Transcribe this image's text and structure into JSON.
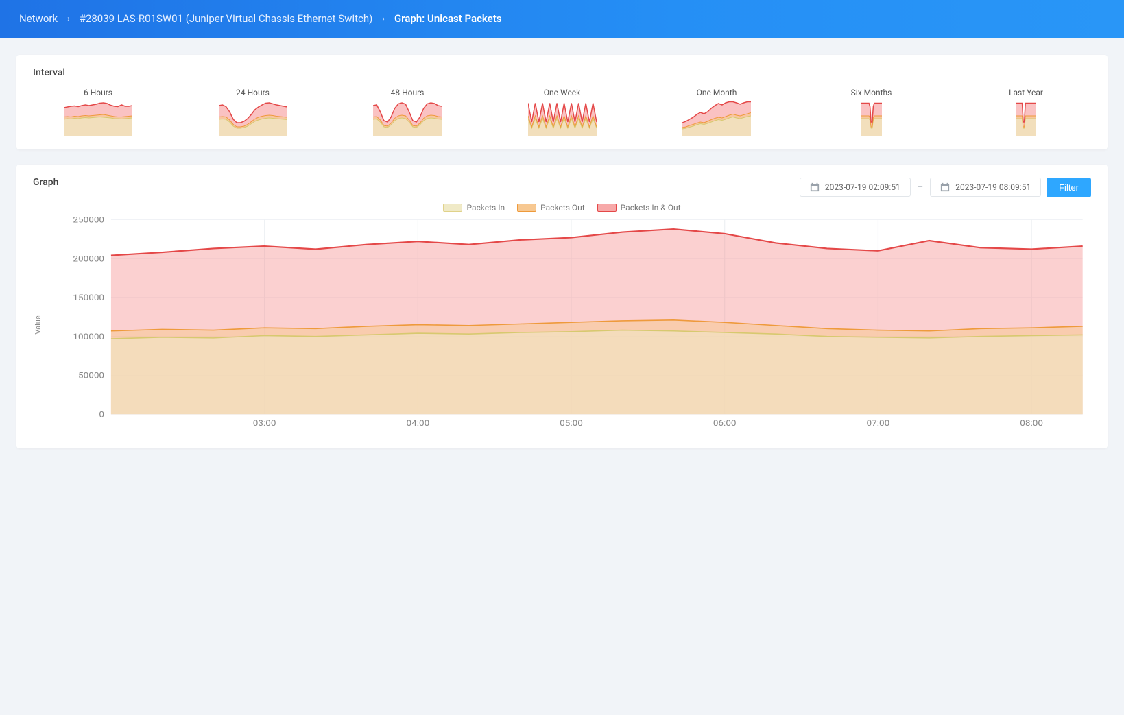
{
  "breadcrumb": {
    "root": "Network",
    "device": "#28039 LAS-R01SW01 (Juniper Virtual Chassis Ethernet Switch)",
    "current": "Graph: Unicast Packets"
  },
  "interval_section": {
    "title": "Interval",
    "items": [
      {
        "id": "6h",
        "label": "6 Hours"
      },
      {
        "id": "24h",
        "label": "24 Hours"
      },
      {
        "id": "48h",
        "label": "48 Hours"
      },
      {
        "id": "1w",
        "label": "One Week"
      },
      {
        "id": "1m",
        "label": "One Month"
      },
      {
        "id": "6m",
        "label": "Six Months"
      },
      {
        "id": "1y",
        "label": "Last Year"
      }
    ]
  },
  "graph_section": {
    "title": "Graph",
    "date_from": "2023-07-19 02:09:51",
    "date_to": "2023-07-19 08:09:51",
    "filter_label": "Filter"
  },
  "legend": {
    "in": "Packets In",
    "out": "Packets Out",
    "both": "Packets In & Out"
  },
  "chart_data": {
    "type": "area",
    "ylabel": "Value",
    "ylim": [
      0,
      250000
    ],
    "yticks": [
      0,
      50000,
      100000,
      150000,
      200000,
      250000
    ],
    "x": [
      "02:09",
      "02:20",
      "02:40",
      "03:00",
      "03:20",
      "03:40",
      "04:00",
      "04:20",
      "04:40",
      "05:00",
      "05:20",
      "05:40",
      "06:00",
      "06:20",
      "06:40",
      "07:00",
      "07:20",
      "07:40",
      "08:00",
      "08:09"
    ],
    "xticks": [
      "03:00",
      "04:00",
      "05:00",
      "06:00",
      "07:00",
      "08:00"
    ],
    "series": [
      {
        "name": "Packets In",
        "values": [
          97000,
          99000,
          98000,
          101000,
          100000,
          102000,
          104000,
          103000,
          105000,
          106000,
          108000,
          107000,
          105000,
          103000,
          100000,
          99000,
          98000,
          100000,
          101000,
          102000
        ]
      },
      {
        "name": "Packets Out",
        "values": [
          107000,
          109000,
          108000,
          111000,
          110000,
          113000,
          115000,
          114000,
          116000,
          118000,
          120000,
          121000,
          118000,
          114000,
          110000,
          108000,
          107000,
          110000,
          111000,
          113000
        ]
      },
      {
        "name": "Packets In & Out",
        "values": [
          204000,
          208000,
          213000,
          216000,
          212000,
          218000,
          222000,
          218000,
          224000,
          227000,
          234000,
          238000,
          232000,
          220000,
          213000,
          210000,
          223000,
          214000,
          212000,
          216000
        ]
      }
    ]
  },
  "spark_data": {
    "6h": {
      "in": [
        0.48,
        0.5,
        0.49,
        0.51,
        0.5,
        0.52,
        0.53,
        0.52,
        0.53,
        0.54,
        0.55,
        0.54,
        0.53,
        0.52,
        0.5,
        0.5,
        0.49,
        0.5,
        0.51,
        0.52
      ],
      "out": [
        0.55,
        0.56,
        0.55,
        0.57,
        0.56,
        0.58,
        0.59,
        0.58,
        0.59,
        0.6,
        0.61,
        0.62,
        0.6,
        0.58,
        0.56,
        0.55,
        0.55,
        0.56,
        0.57,
        0.58
      ],
      "both": [
        0.82,
        0.84,
        0.86,
        0.87,
        0.85,
        0.88,
        0.9,
        0.88,
        0.9,
        0.92,
        0.95,
        0.96,
        0.94,
        0.89,
        0.86,
        0.85,
        0.9,
        0.86,
        0.86,
        0.88
      ]
    },
    "24h": {
      "in": [
        0.48,
        0.49,
        0.48,
        0.4,
        0.28,
        0.22,
        0.22,
        0.24,
        0.28,
        0.35,
        0.42,
        0.46,
        0.49,
        0.51,
        0.52,
        0.51,
        0.5,
        0.49,
        0.48,
        0.47
      ],
      "out": [
        0.55,
        0.56,
        0.55,
        0.46,
        0.33,
        0.26,
        0.26,
        0.28,
        0.33,
        0.41,
        0.49,
        0.54,
        0.57,
        0.59,
        0.6,
        0.59,
        0.57,
        0.56,
        0.55,
        0.54
      ],
      "both": [
        0.88,
        0.9,
        0.85,
        0.7,
        0.48,
        0.38,
        0.38,
        0.42,
        0.5,
        0.62,
        0.76,
        0.84,
        0.9,
        0.95,
        0.96,
        0.93,
        0.9,
        0.88,
        0.86,
        0.84
      ]
    },
    "48h": {
      "in": [
        0.48,
        0.49,
        0.4,
        0.26,
        0.24,
        0.32,
        0.44,
        0.5,
        0.52,
        0.5,
        0.4,
        0.26,
        0.24,
        0.32,
        0.44,
        0.5,
        0.52,
        0.51,
        0.49,
        0.48
      ],
      "out": [
        0.55,
        0.56,
        0.46,
        0.3,
        0.28,
        0.37,
        0.51,
        0.58,
        0.6,
        0.58,
        0.46,
        0.3,
        0.28,
        0.37,
        0.51,
        0.58,
        0.6,
        0.59,
        0.56,
        0.55
      ],
      "both": [
        0.88,
        0.9,
        0.7,
        0.44,
        0.4,
        0.55,
        0.8,
        0.93,
        0.96,
        0.92,
        0.7,
        0.44,
        0.4,
        0.55,
        0.8,
        0.93,
        0.96,
        0.94,
        0.88,
        0.86
      ]
    },
    "1w": {
      "in": [
        0.5,
        0.22,
        0.5,
        0.22,
        0.5,
        0.22,
        0.5,
        0.22,
        0.5,
        0.22,
        0.5,
        0.22,
        0.5,
        0.22,
        0.5,
        0.22,
        0.5,
        0.22,
        0.5,
        0.22
      ],
      "out": [
        0.58,
        0.26,
        0.58,
        0.26,
        0.58,
        0.26,
        0.58,
        0.26,
        0.58,
        0.26,
        0.58,
        0.26,
        0.58,
        0.26,
        0.58,
        0.26,
        0.58,
        0.26,
        0.58,
        0.26
      ],
      "both": [
        0.95,
        0.4,
        0.95,
        0.4,
        0.95,
        0.4,
        0.95,
        0.4,
        0.95,
        0.4,
        0.95,
        0.4,
        0.95,
        0.4,
        0.95,
        0.4,
        0.95,
        0.4,
        0.95,
        0.4
      ]
    },
    "1m": {
      "in": [
        0.2,
        0.22,
        0.25,
        0.28,
        0.32,
        0.35,
        0.33,
        0.36,
        0.4,
        0.44,
        0.47,
        0.45,
        0.48,
        0.52,
        0.55,
        0.52,
        0.5,
        0.53,
        0.56,
        0.58
      ],
      "out": [
        0.24,
        0.26,
        0.3,
        0.33,
        0.37,
        0.4,
        0.38,
        0.42,
        0.47,
        0.51,
        0.54,
        0.52,
        0.56,
        0.6,
        0.63,
        0.6,
        0.58,
        0.61,
        0.64,
        0.67
      ],
      "both": [
        0.38,
        0.42,
        0.48,
        0.54,
        0.62,
        0.68,
        0.64,
        0.7,
        0.8,
        0.88,
        0.94,
        0.9,
        0.96,
        0.99,
        0.99,
        0.96,
        0.92,
        0.96,
        0.99,
        0.99
      ]
    },
    "6m": {
      "in": [
        0.5,
        0.5,
        0.5,
        0.5,
        0.5,
        0.5,
        0.5,
        0.5,
        0.45,
        0.22,
        0.22,
        0.45,
        0.5,
        0.5,
        0.5,
        0.5,
        0.5,
        0.5,
        0.5,
        0.5
      ],
      "out": [
        0.58,
        0.58,
        0.58,
        0.58,
        0.58,
        0.58,
        0.58,
        0.58,
        0.52,
        0.26,
        0.26,
        0.52,
        0.58,
        0.58,
        0.58,
        0.58,
        0.58,
        0.58,
        0.58,
        0.58
      ],
      "both": [
        0.95,
        0.95,
        0.95,
        0.95,
        0.95,
        0.95,
        0.95,
        0.95,
        0.85,
        0.4,
        0.4,
        0.85,
        0.95,
        0.95,
        0.95,
        0.95,
        0.95,
        0.95,
        0.95,
        0.95
      ],
      "narrow": true
    },
    "1y": {
      "in": [
        0.5,
        0.5,
        0.5,
        0.5,
        0.5,
        0.5,
        0.5,
        0.22,
        0.22,
        0.5,
        0.5,
        0.5,
        0.5,
        0.5,
        0.5,
        0.5,
        0.5,
        0.5,
        0.5,
        0.5
      ],
      "out": [
        0.58,
        0.58,
        0.58,
        0.58,
        0.58,
        0.58,
        0.58,
        0.26,
        0.26,
        0.58,
        0.58,
        0.58,
        0.58,
        0.58,
        0.58,
        0.58,
        0.58,
        0.58,
        0.58,
        0.58
      ],
      "both": [
        0.95,
        0.95,
        0.95,
        0.95,
        0.95,
        0.95,
        0.95,
        0.4,
        0.4,
        0.95,
        0.95,
        0.95,
        0.95,
        0.95,
        0.95,
        0.95,
        0.95,
        0.95,
        0.95,
        0.95
      ],
      "narrow": true
    }
  }
}
